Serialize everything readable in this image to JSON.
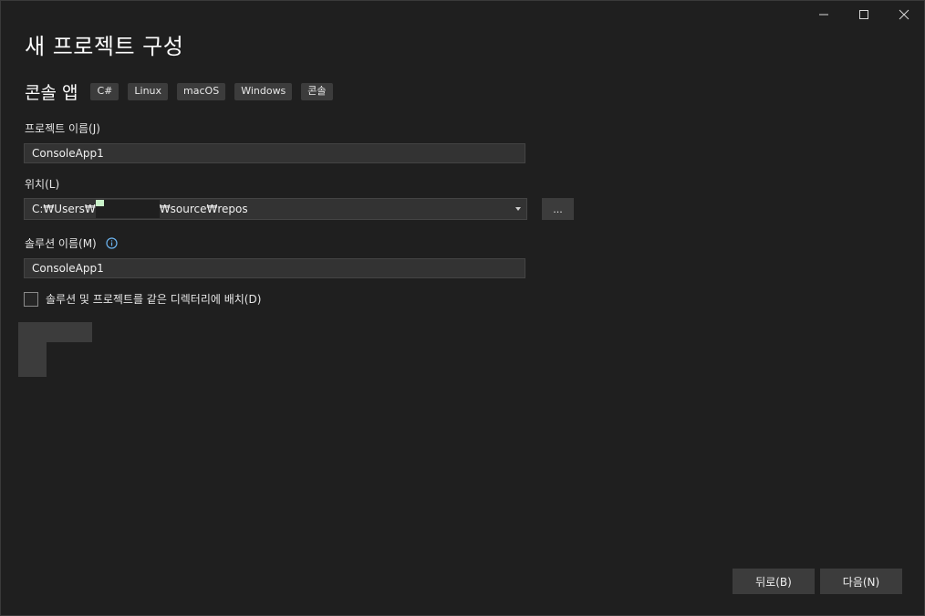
{
  "window_controls": {
    "minimize_icon": "minimize-icon",
    "maximize_icon": "maximize-icon",
    "close_icon": "close-icon"
  },
  "page_title": "새 프로젝트 구성",
  "template": {
    "name": "콘솔 앱",
    "tags": [
      "C#",
      "Linux",
      "macOS",
      "Windows",
      "콘솔"
    ]
  },
  "project_name": {
    "label": "프로젝트 이름(J)",
    "value": "ConsoleApp1"
  },
  "location": {
    "label": "위치(L)",
    "prefix": "C:₩Users₩",
    "suffix": "₩source₩repos",
    "browse_label": "..."
  },
  "solution_name": {
    "label": "솔루션 이름(M)",
    "value": "ConsoleApp1",
    "info_icon": "info-icon"
  },
  "same_dir_checkbox": {
    "label": "솔루션 및 프로젝트를 같은 디렉터리에 배치(D)",
    "checked": false
  },
  "footer": {
    "back_label": "뒤로(B)",
    "next_label": "다음(N)"
  },
  "colors": {
    "background": "#1f1f1f",
    "input_bg": "#333333",
    "button_bg": "#3c3c3c",
    "info_accent": "#6cb4f0"
  }
}
